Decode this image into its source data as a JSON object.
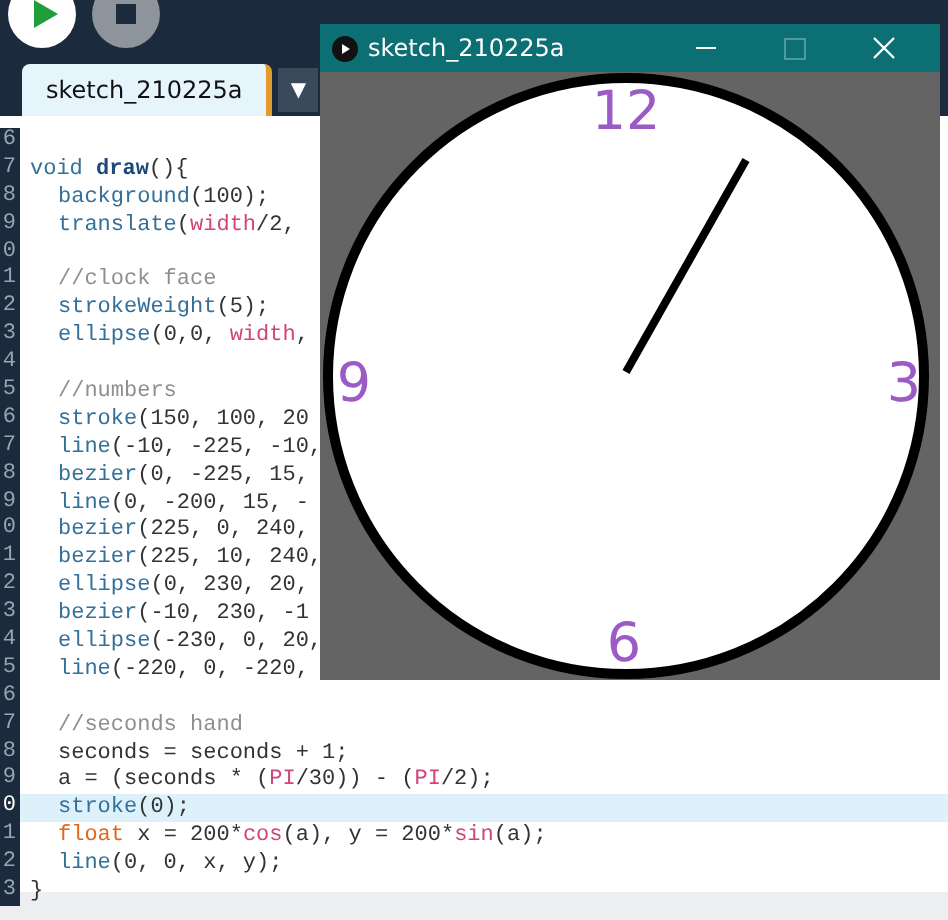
{
  "toolbar": {
    "buttons": [
      {
        "kind": "run"
      },
      {
        "kind": "stop"
      }
    ]
  },
  "tabs": [
    {
      "label": "sketch_210225a",
      "selected": true
    }
  ],
  "tab_menu": "▼",
  "editor": {
    "lines": [
      {
        "num": "6",
        "highlighted": false
      },
      {
        "num": "7",
        "indented": false,
        "highlighted": false,
        "tokens": [
          {
            "text": "void ",
            "kind": "kw"
          },
          {
            "text": "draw",
            "kind": "def"
          },
          {
            "text": "(){",
            "kind": "plain"
          }
        ]
      },
      {
        "num": "8",
        "indented": true,
        "highlighted": false,
        "tokens": [
          {
            "text": "background",
            "kind": "fn"
          },
          {
            "text": "(100);",
            "kind": "plain"
          }
        ]
      },
      {
        "num": "9",
        "indented": true,
        "highlighted": false,
        "tokens": [
          {
            "text": "translate",
            "kind": "fn"
          },
          {
            "text": "(",
            "kind": "plain"
          },
          {
            "text": "width",
            "kind": "var"
          },
          {
            "text": "/2,",
            "kind": "plain"
          }
        ]
      },
      {
        "num": "0",
        "highlighted": false
      },
      {
        "num": "1",
        "indented": true,
        "highlighted": false,
        "tokens": [
          {
            "text": "//clock face",
            "kind": "comment"
          }
        ]
      },
      {
        "num": "2",
        "indented": true,
        "highlighted": false,
        "tokens": [
          {
            "text": "strokeWeight",
            "kind": "fn"
          },
          {
            "text": "(5);",
            "kind": "plain"
          }
        ]
      },
      {
        "num": "3",
        "indented": true,
        "highlighted": false,
        "tokens": [
          {
            "text": "ellipse",
            "kind": "fn"
          },
          {
            "text": "(0,0, ",
            "kind": "plain"
          },
          {
            "text": "width",
            "kind": "var"
          },
          {
            "text": ",",
            "kind": "plain"
          }
        ]
      },
      {
        "num": "4",
        "highlighted": false
      },
      {
        "num": "5",
        "indented": true,
        "highlighted": false,
        "tokens": [
          {
            "text": "//numbers",
            "kind": "comment"
          }
        ]
      },
      {
        "num": "6",
        "indented": true,
        "highlighted": false,
        "tokens": [
          {
            "text": "stroke",
            "kind": "fn"
          },
          {
            "text": "(150, 100, 20",
            "kind": "plain"
          }
        ]
      },
      {
        "num": "7",
        "indented": true,
        "highlighted": false,
        "tokens": [
          {
            "text": "line",
            "kind": "fn"
          },
          {
            "text": "(-10, -225, -10,",
            "kind": "plain"
          }
        ]
      },
      {
        "num": "8",
        "indented": true,
        "highlighted": false,
        "tokens": [
          {
            "text": "bezier",
            "kind": "fn"
          },
          {
            "text": "(0, -225, 15,",
            "kind": "plain"
          }
        ]
      },
      {
        "num": "9",
        "indented": true,
        "highlighted": false,
        "tokens": [
          {
            "text": "line",
            "kind": "fn"
          },
          {
            "text": "(0, -200, 15, -",
            "kind": "plain"
          }
        ]
      },
      {
        "num": "0",
        "indented": true,
        "highlighted": false,
        "tokens": [
          {
            "text": "bezier",
            "kind": "fn"
          },
          {
            "text": "(225, 0, 240,",
            "kind": "plain"
          }
        ]
      },
      {
        "num": "1",
        "indented": true,
        "highlighted": false,
        "tokens": [
          {
            "text": "bezier",
            "kind": "fn"
          },
          {
            "text": "(225, 10, 240,",
            "kind": "plain"
          }
        ]
      },
      {
        "num": "2",
        "indented": true,
        "highlighted": false,
        "tokens": [
          {
            "text": "ellipse",
            "kind": "fn"
          },
          {
            "text": "(0, 230, 20,",
            "kind": "plain"
          }
        ]
      },
      {
        "num": "3",
        "indented": true,
        "highlighted": false,
        "tokens": [
          {
            "text": "bezier",
            "kind": "fn"
          },
          {
            "text": "(-10, 230, -1",
            "kind": "plain"
          }
        ]
      },
      {
        "num": "4",
        "indented": true,
        "highlighted": false,
        "tokens": [
          {
            "text": "ellipse",
            "kind": "fn"
          },
          {
            "text": "(-230, 0, 20,",
            "kind": "plain"
          }
        ]
      },
      {
        "num": "5",
        "indented": true,
        "highlighted": false,
        "tokens": [
          {
            "text": "line",
            "kind": "fn"
          },
          {
            "text": "(-220, 0, -220,",
            "kind": "plain"
          }
        ]
      },
      {
        "num": "6",
        "highlighted": false
      },
      {
        "num": "7",
        "indented": true,
        "highlighted": false,
        "tokens": [
          {
            "text": "//seconds hand",
            "kind": "comment"
          }
        ]
      },
      {
        "num": "8",
        "indented": true,
        "highlighted": false,
        "tokens": [
          {
            "text": "seconds = seconds + 1;",
            "kind": "plain"
          }
        ]
      },
      {
        "num": "9",
        "indented": true,
        "highlighted": false,
        "tokens": [
          {
            "text": "a = (seconds * (",
            "kind": "plain"
          },
          {
            "text": "PI",
            "kind": "var"
          },
          {
            "text": "/30)) - (",
            "kind": "plain"
          },
          {
            "text": "PI",
            "kind": "var"
          },
          {
            "text": "/2);",
            "kind": "plain"
          }
        ]
      },
      {
        "num": "0",
        "indented": true,
        "highlighted": true,
        "tokens": [
          {
            "text": "stroke",
            "kind": "fn"
          },
          {
            "text": "(0);",
            "kind": "plain"
          }
        ]
      },
      {
        "num": "1",
        "indented": true,
        "highlighted": false,
        "tokens": [
          {
            "text": "float",
            "kind": "type"
          },
          {
            "text": " x = 200*",
            "kind": "plain"
          },
          {
            "text": "cos",
            "kind": "var"
          },
          {
            "text": "(a), y = 200*",
            "kind": "plain"
          },
          {
            "text": "sin",
            "kind": "var"
          },
          {
            "text": "(a);",
            "kind": "plain"
          }
        ]
      },
      {
        "num": "2",
        "indented": true,
        "highlighted": false,
        "tokens": [
          {
            "text": "line",
            "kind": "fn"
          },
          {
            "text": "(0, 0, x, y);",
            "kind": "plain"
          }
        ]
      },
      {
        "num": "3",
        "indented": false,
        "highlighted": false,
        "tokens": [
          {
            "text": "}",
            "kind": "plain"
          }
        ]
      }
    ]
  },
  "sketch_window": {
    "title": "sketch_210225a",
    "clock": {
      "numerals": [
        "12",
        "3",
        "6",
        "9"
      ]
    }
  }
}
